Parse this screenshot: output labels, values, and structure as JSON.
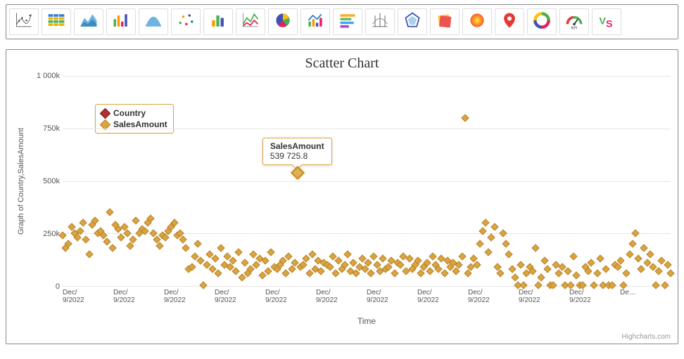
{
  "toolbar_icons": [
    "scatter-sketch-icon",
    "table-icon",
    "area-chart-icon",
    "column-chart-icon",
    "bell-curve-icon",
    "scatter-color-icon",
    "bar-chart-icon",
    "line-chart-icon",
    "pie-chart-icon",
    "combo-chart-icon",
    "list-chart-icon",
    "range-chart-icon",
    "polygon-chart-icon",
    "card-icon",
    "sunburst-icon",
    "map-pin-icon",
    "donut-icon",
    "gauge-kpi-icon",
    "vs-icon"
  ],
  "chart": {
    "title": "Scatter Chart",
    "ylabel": "Graph of Country,SalesAmount",
    "xlabel": "Time",
    "credits": "Highcharts.com",
    "y_ticks": [
      "0",
      "250k",
      "500k",
      "750k",
      "1 000k"
    ],
    "x_ticks": [
      "Dec/\n9/2022",
      "Dec/\n9/2022",
      "Dec/\n9/2022",
      "Dec/\n9/2022",
      "Dec/\n9/2022",
      "Dec/\n9/2022",
      "Dec/\n9/2022",
      "Dec/\n9/2022",
      "Dec/\n9/2022",
      "Dec/\n9/2022",
      "Dec/\n9/2022",
      "De…"
    ],
    "x_trailing_tick": "De…",
    "legend": {
      "items": [
        {
          "label": "Country",
          "color": "#b03030"
        },
        {
          "label": "SalesAmount",
          "color": "#d9a441"
        }
      ]
    },
    "tooltip": {
      "title": "SalesAmount",
      "value": "539 725.8"
    }
  },
  "chart_data": {
    "type": "scatter",
    "title": "Scatter Chart",
    "xlabel": "Time",
    "ylabel": "Graph of Country,SalesAmount",
    "ylim": [
      0,
      1000000
    ],
    "x_tick_label": "Dec/9/2022",
    "series": [
      {
        "name": "SalesAmount",
        "color": "#d9a441",
        "comment": "y values are approximate sales amounts read from the chart; highlighted point value 539725.8 is exact from tooltip",
        "values": [
          240000,
          180000,
          200000,
          280000,
          250000,
          230000,
          260000,
          300000,
          220000,
          150000,
          290000,
          310000,
          250000,
          260000,
          240000,
          210000,
          350000,
          180000,
          290000,
          270000,
          230000,
          280000,
          250000,
          190000,
          220000,
          310000,
          250000,
          270000,
          260000,
          300000,
          320000,
          250000,
          220000,
          190000,
          240000,
          230000,
          260000,
          280000,
          300000,
          240000,
          250000,
          220000,
          180000,
          80000,
          90000,
          140000,
          200000,
          120000,
          5000,
          100000,
          150000,
          80000,
          130000,
          60000,
          180000,
          100000,
          140000,
          90000,
          120000,
          70000,
          160000,
          40000,
          110000,
          60000,
          80000,
          150000,
          100000,
          130000,
          50000,
          120000,
          70000,
          160000,
          90000,
          80000,
          100000,
          120000,
          60000,
          140000,
          80000,
          110000,
          539725.8,
          90000,
          100000,
          130000,
          60000,
          150000,
          80000,
          120000,
          70000,
          110000,
          100000,
          90000,
          140000,
          60000,
          120000,
          80000,
          100000,
          150000,
          70000,
          110000,
          60000,
          90000,
          130000,
          80000,
          110000,
          60000,
          140000,
          100000,
          70000,
          130000,
          80000,
          90000,
          120000,
          60000,
          110000,
          100000,
          140000,
          70000,
          130000,
          80000,
          100000,
          120000,
          60000,
          90000,
          110000,
          70000,
          140000,
          100000,
          80000,
          130000,
          60000,
          120000,
          90000,
          110000,
          70000,
          100000,
          140000,
          800000,
          60000,
          90000,
          130000,
          100000,
          200000,
          260000,
          300000,
          160000,
          230000,
          280000,
          90000,
          60000,
          250000,
          200000,
          150000,
          80000,
          40000,
          5000,
          100000,
          5000,
          60000,
          90000,
          70000,
          180000,
          5000,
          40000,
          120000,
          80000,
          5000,
          5000,
          100000,
          60000,
          90000,
          5000,
          70000,
          5000,
          140000,
          50000,
          5000,
          5000,
          90000,
          70000,
          110000,
          5000,
          60000,
          130000,
          5000,
          80000,
          5000,
          5000,
          100000,
          90000,
          120000,
          5000,
          60000,
          150000,
          200000,
          250000,
          130000,
          80000,
          180000,
          110000,
          150000,
          90000,
          5000,
          70000,
          120000,
          5000,
          100000,
          60000
        ]
      },
      {
        "name": "Country",
        "color": "#b03030",
        "values": []
      }
    ]
  }
}
